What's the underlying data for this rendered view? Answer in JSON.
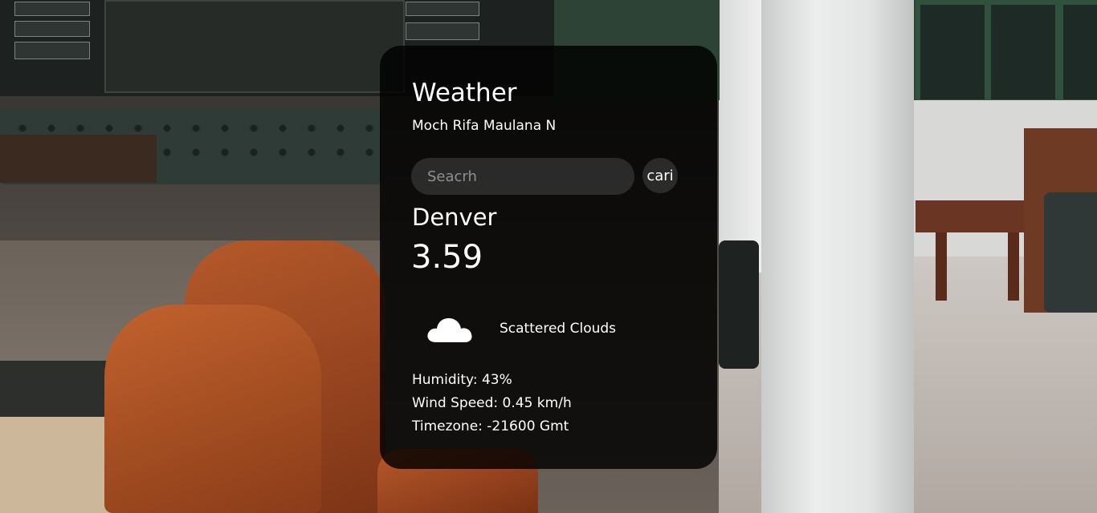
{
  "app": {
    "title": "Weather",
    "author": "Moch Rifa Maulana N"
  },
  "search": {
    "placeholder": "Seacrh",
    "value": "",
    "button_label": "cari"
  },
  "weather": {
    "city": "Denver",
    "temperature": "3.59",
    "icon": "cloud-icon",
    "description": "Scattered Clouds",
    "humidity_text": "Humidity: 43%",
    "wind_text": "Wind Speed: 0.45 km/h",
    "timezone_text": "Timezone: -21600 Gmt"
  },
  "colors": {
    "card_background": "#000000",
    "text": "#ffffff",
    "input_background": "#6e6e6e"
  }
}
